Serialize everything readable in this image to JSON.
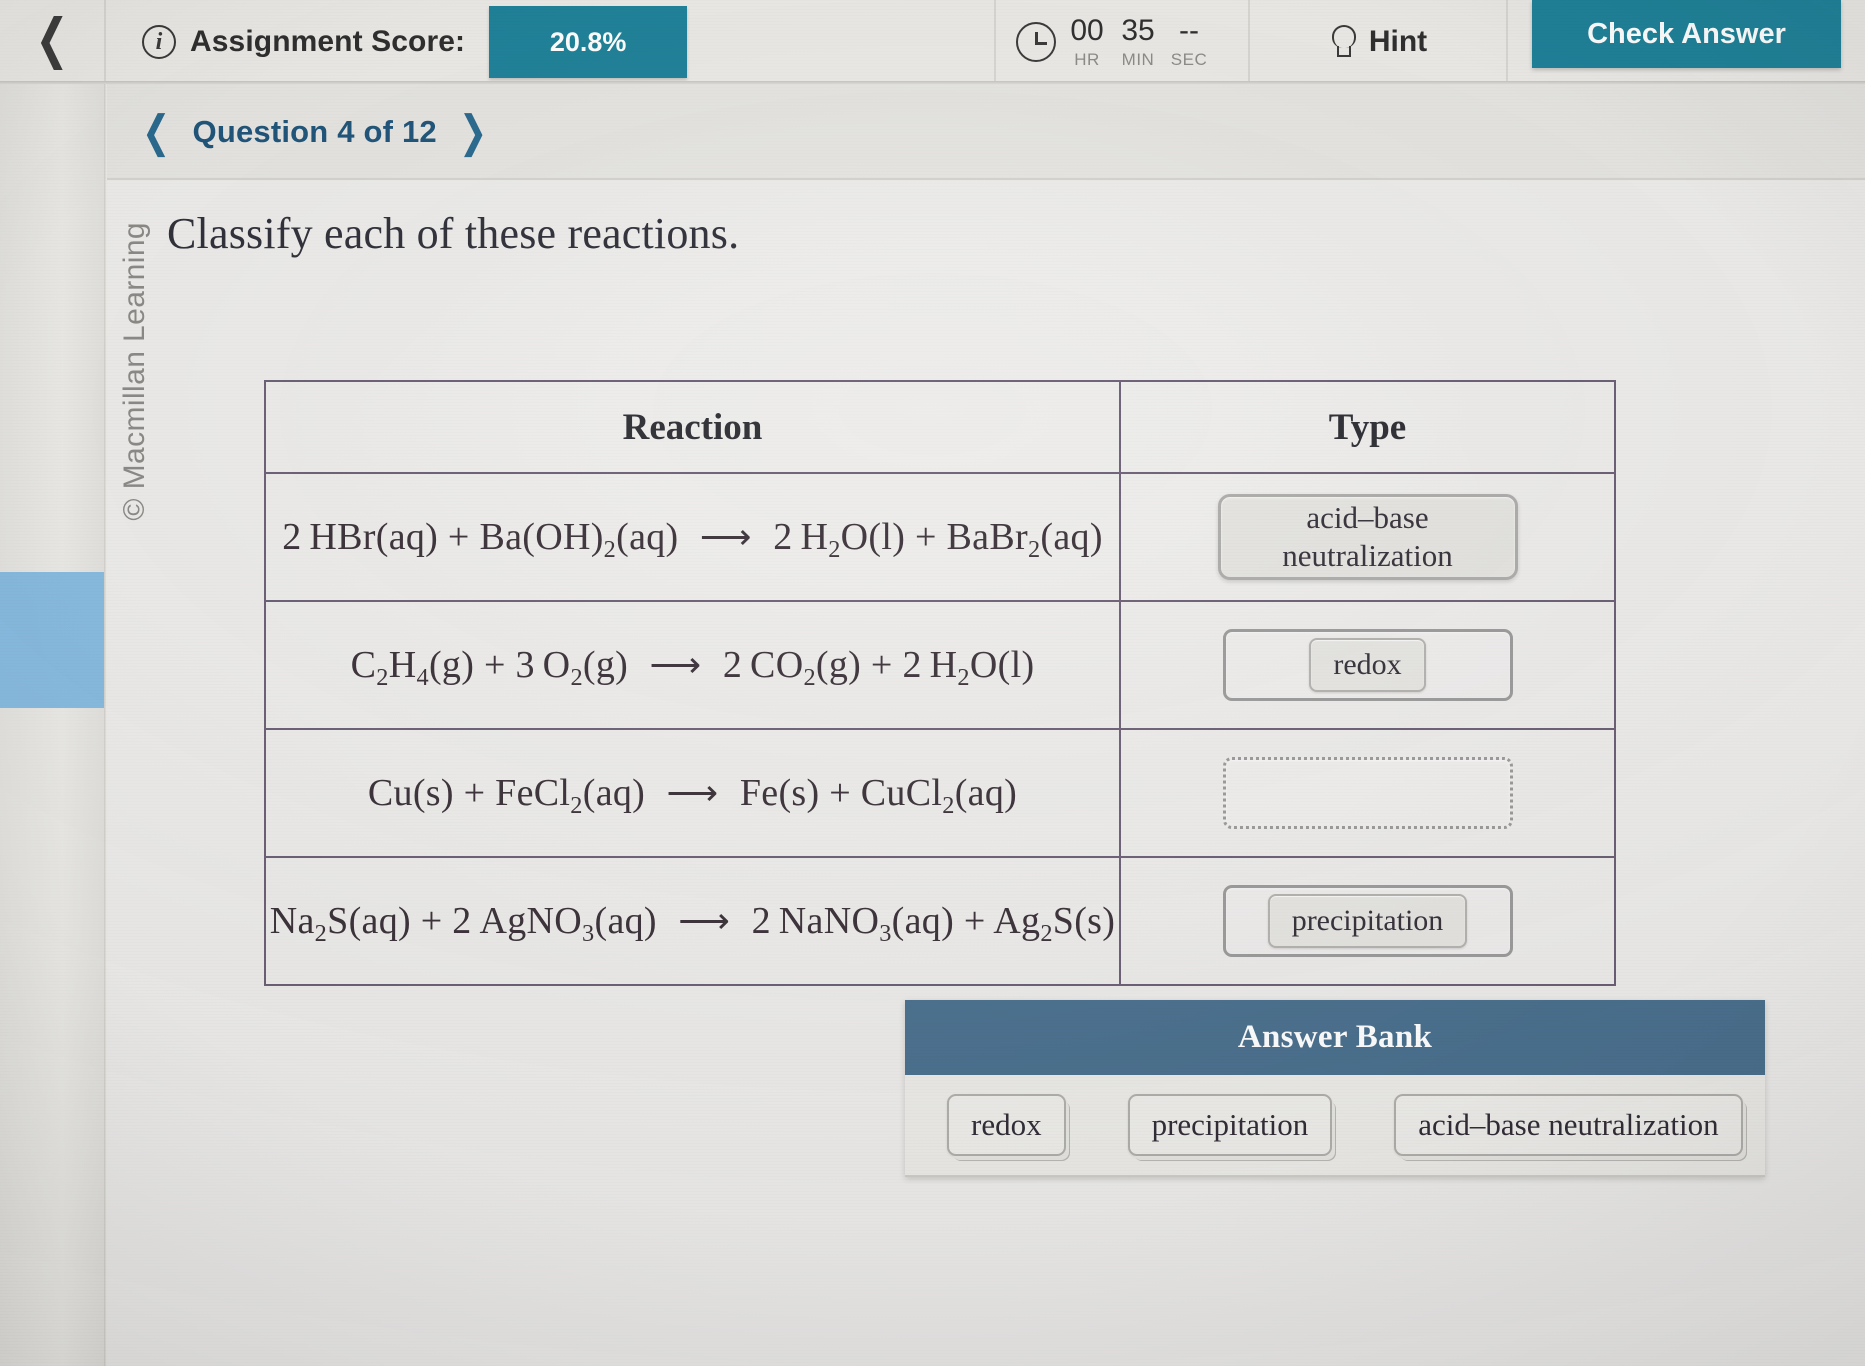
{
  "topbar": {
    "back_icon": "chevron-left-icon",
    "info_icon": "info-icon",
    "score_label": "Assignment Score:",
    "score_value": "20.8%",
    "clock_icon": "clock-icon",
    "timer": {
      "hr": "00",
      "min": "35",
      "sec": "--",
      "unit_hr": "HR",
      "unit_min": "MIN",
      "unit_sec": "SEC"
    },
    "hint_icon": "lightbulb-icon",
    "hint_label": "Hint",
    "check_label": "Check Answer",
    "accent_color": "#1f8299"
  },
  "qnav": {
    "prev_icon": "chevron-left-icon",
    "next_icon": "chevron-right-icon",
    "label": "Question 4 of 12",
    "color": "#20557a"
  },
  "watermark": "© Macmillan Learning",
  "main": {
    "prompt": "Classify each of these reactions."
  },
  "table": {
    "headers": {
      "reaction": "Reaction",
      "type": "Type"
    },
    "rows": [
      {
        "equation_text": "2 HBr(aq) + Ba(OH)2(aq) ⟶ 2 H2O(l) + BaBr2(aq)",
        "equation_html": "2 HBr(aq) + Ba(OH)<sub>2</sub>(aq) <span class=\"arrow\">⟶</span> 2 H<sub>2</sub>O(l) + BaBr<sub>2</sub>(aq)",
        "answer": "acid–base neutralization",
        "answer_line1": "acid–base",
        "answer_line2": "neutralization",
        "filled": true,
        "two_line": true
      },
      {
        "equation_text": "C2H4(g) + 3 O2(g) ⟶ 2 CO2(g) + 2 H2O(l)",
        "equation_html": "C<sub>2</sub>H<sub>4</sub>(g) + 3 O<sub>2</sub>(g) <span class=\"arrow\">⟶</span> 2 CO<sub>2</sub>(g) + 2 H<sub>2</sub>O(l)",
        "answer": "redox",
        "filled": true,
        "two_line": false
      },
      {
        "equation_text": "Cu(s) + FeCl2(aq) ⟶ Fe(s) + CuCl2(aq)",
        "equation_html": "Cu(s) + FeCl<sub>2</sub>(aq) <span class=\"arrow\">⟶</span> Fe(s) + CuCl<sub>2</sub>(aq)",
        "answer": "",
        "filled": false,
        "two_line": false
      },
      {
        "equation_text": "Na2S(aq) + 2 AgNO3(aq) ⟶ 2 NaNO3(aq) + Ag2S(s)",
        "equation_html": "Na<sub>2</sub>S(aq) + 2 AgNO<sub>3</sub>(aq) <span class=\"arrow\">⟶</span> 2 NaNO<sub>3</sub>(aq) + Ag<sub>2</sub>S(s)",
        "answer": "precipitation",
        "filled": true,
        "two_line": false
      }
    ]
  },
  "answer_bank": {
    "title": "Answer Bank",
    "header_color": "#4a708e",
    "chips": [
      "redox",
      "precipitation",
      "acid–base neutralization"
    ]
  }
}
